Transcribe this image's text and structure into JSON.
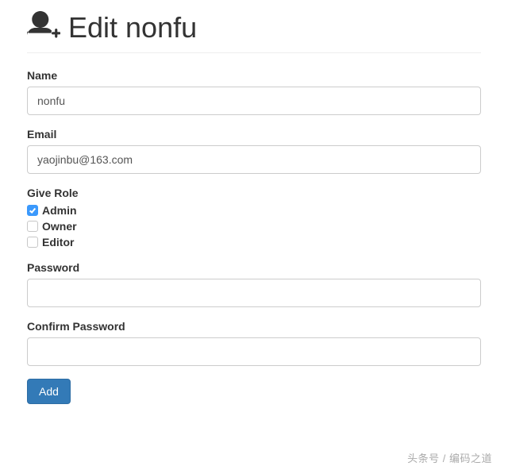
{
  "header": {
    "title": "Edit nonfu"
  },
  "form": {
    "name": {
      "label": "Name",
      "value": "nonfu"
    },
    "email": {
      "label": "Email",
      "value": "yaojinbu@163.com"
    },
    "roles": {
      "label": "Give Role",
      "items": [
        {
          "label": "Admin",
          "checked": true
        },
        {
          "label": "Owner",
          "checked": false
        },
        {
          "label": "Editor",
          "checked": false
        }
      ]
    },
    "password": {
      "label": "Password",
      "value": ""
    },
    "confirm_password": {
      "label": "Confirm Password",
      "value": ""
    },
    "submit_label": "Add"
  },
  "watermark": "头条号 / 编码之道"
}
